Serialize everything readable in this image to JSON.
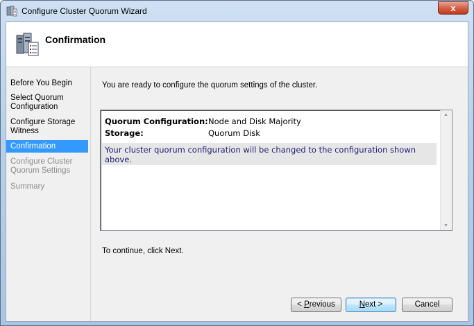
{
  "window": {
    "title": "Configure Cluster Quorum Wizard",
    "close_glyph": "x"
  },
  "header": {
    "title": "Confirmation"
  },
  "nav": {
    "items": [
      {
        "label": "Before You Begin",
        "state": "normal"
      },
      {
        "label": "Select Quorum Configuration",
        "state": "normal"
      },
      {
        "label": "Configure Storage Witness",
        "state": "normal"
      },
      {
        "label": "Confirmation",
        "state": "active"
      },
      {
        "label": "Configure Cluster Quorum Settings",
        "state": "disabled"
      },
      {
        "label": "Summary",
        "state": "disabled"
      }
    ]
  },
  "main": {
    "intro": "You are ready to configure the quorum settings of the cluster.",
    "summary": {
      "rows": [
        {
          "key": "Quorum Configuration:",
          "value": "Node and Disk Majority"
        },
        {
          "key": "Storage:",
          "value": "Quorum Disk"
        }
      ],
      "note": "Your cluster quorum configuration will be changed to the configuration shown above."
    },
    "continue_text": "To continue, click Next."
  },
  "buttons": {
    "previous": {
      "prefix": "< ",
      "mnemonic": "P",
      "rest": "revious"
    },
    "next": {
      "mnemonic": "N",
      "rest": "ext >"
    },
    "cancel": "Cancel"
  },
  "colors": {
    "selection": "#3399ff",
    "note_text": "#1e1e7a",
    "disabled_text": "#8d8d8d"
  }
}
